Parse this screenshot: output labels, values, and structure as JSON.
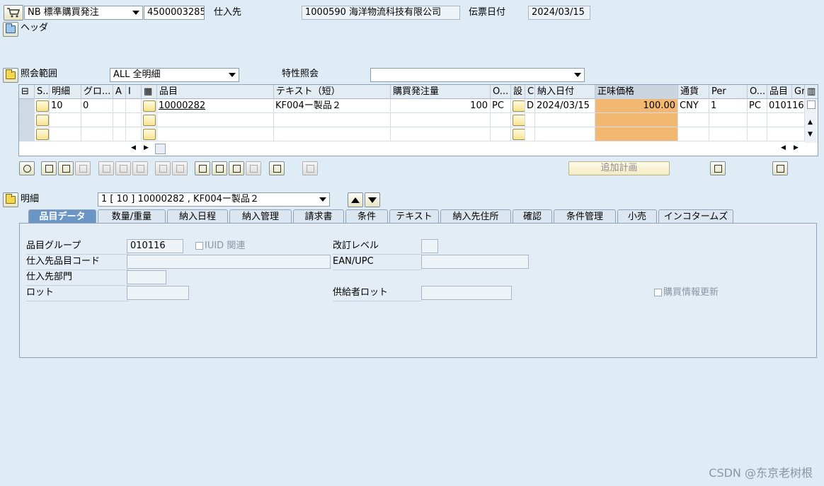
{
  "header": {
    "doc_type": "NB 標準購買発注",
    "doc_number": "4500003285",
    "supplier_label": "仕入先",
    "supplier_value": "1000590 海洋物流科技有限公司",
    "doc_date_label": "伝票日付",
    "doc_date_value": "2024/03/15",
    "header_section_label": "ヘッダ"
  },
  "scope": {
    "label": "照会範囲",
    "value": "ALL 全明細",
    "char_label": "特性照会",
    "char_value": ""
  },
  "grid": {
    "columns": [
      "S..",
      "明細",
      "グロ...",
      "A",
      "I",
      "品目",
      "テキスト（短）",
      "購買発注量",
      "O...",
      "設",
      "C",
      "納入日付",
      "正味価格",
      "通貨",
      "Per",
      "O...",
      "品目",
      "Gr"
    ],
    "rows": [
      {
        "item": "10",
        "group": "0",
        "material": "10000282",
        "short_text": "KF004ー製品２",
        "quantity": "100",
        "unit": "PC",
        "c": "D",
        "delivery_date": "2024/03/15",
        "net_price": "100.00",
        "currency": "CNY",
        "per": "1",
        "order_unit": "PC",
        "material_group": "010116"
      }
    ]
  },
  "toolbar": {
    "delivery_plan_button": "追加計画"
  },
  "detail": {
    "label": "明細",
    "selected_item": "1 [ 10 ] 10000282 , KF004ー製品２"
  },
  "tabs": [
    "品目データ",
    "数量/重量",
    "納入日程",
    "納入管理",
    "請求書",
    "条件",
    "テキスト",
    "納入先住所",
    "確認",
    "条件管理",
    "小売",
    "インコタームズ"
  ],
  "item_data": {
    "material_group_label": "品目グループ",
    "material_group_value": "010116",
    "iuid_label": "IUID 関連",
    "revision_label": "改訂レベル",
    "revision_value": "",
    "supplier_mat_label": "仕入先品目コード",
    "supplier_mat_value": "",
    "ean_label": "EAN/UPC",
    "ean_value": "",
    "supplier_dept_label": "仕入先部門",
    "supplier_dept_value": "",
    "lot_label": "ロット",
    "lot_value": "",
    "supplier_lot_label": "供給者ロット",
    "supplier_lot_value": "",
    "info_update_label": "購買情報更新"
  },
  "watermark": "CSDN @东京老树根",
  "colors": {
    "background": "#dfebf5",
    "active_tab": "#6b95c4",
    "highlight_price": "#f2b872"
  }
}
